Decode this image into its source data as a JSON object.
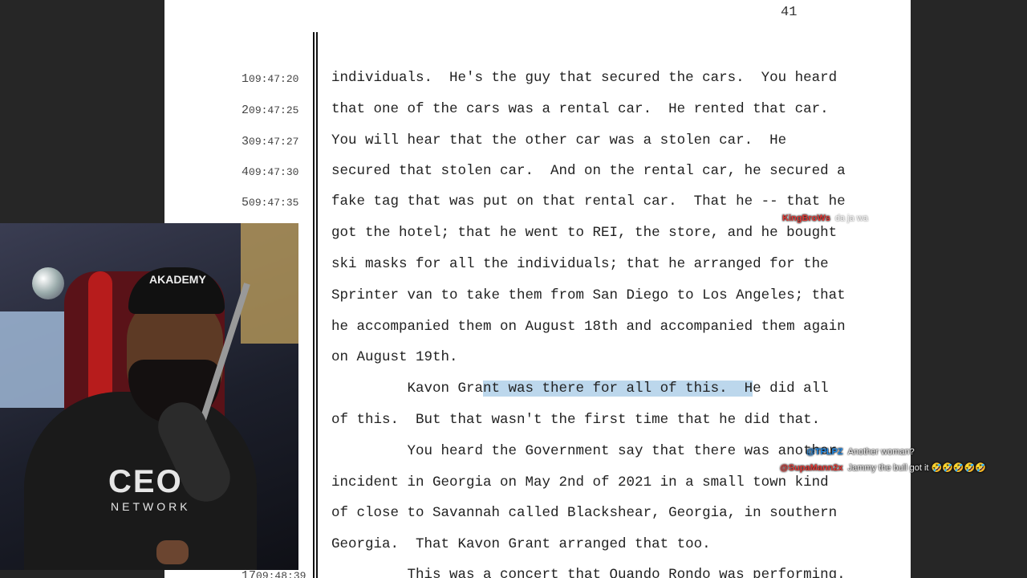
{
  "document": {
    "page_number": "41",
    "lines": [
      {
        "num": "1",
        "time": "09:47:20",
        "text": "individuals.  He's the guy that secured the cars.  You heard"
      },
      {
        "num": "2",
        "time": "09:47:25",
        "text": "that one of the cars was a rental car.  He rented that car."
      },
      {
        "num": "3",
        "time": "09:47:27",
        "text": "You will hear that the other car was a stolen car.  He"
      },
      {
        "num": "4",
        "time": "09:47:30",
        "text": "secured that stolen car.  And on the rental car, he secured a"
      },
      {
        "num": "5",
        "time": "09:47:35",
        "text": "fake tag that was put on that rental car.  That he -- that he"
      },
      {
        "num": "",
        "time": "",
        "text": "got the hotel; that he went to REI, the store, and he bought"
      },
      {
        "num": "",
        "time": "",
        "text": "ski masks for all the individuals; that he arranged for the"
      },
      {
        "num": "",
        "time": "",
        "text": "Sprinter van to take them from San Diego to Los Angeles; that"
      },
      {
        "num": "",
        "time": "",
        "text": "he accompanied them on August 18th and accompanied them again"
      },
      {
        "num": "",
        "time": "",
        "text": "on August 19th."
      },
      {
        "num": "",
        "time": "",
        "text": "",
        "pre": "         Kavon Gra",
        "highlight": "nt was there for all of this.  H",
        "post": "e did all"
      },
      {
        "num": "",
        "time": "",
        "text": "of this.  But that wasn't the first time that he did that."
      },
      {
        "num": "",
        "time": "",
        "text": "         You heard the Government say that there was another"
      },
      {
        "num": "",
        "time": "",
        "text": "incident in Georgia on May 2nd of 2021 in a small town kind"
      },
      {
        "num": "",
        "time": "",
        "text": "of close to Savannah called Blackshear, Georgia, in southern"
      },
      {
        "num": "",
        "time": "",
        "text": "Georgia.  That Kavon Grant arranged that too."
      },
      {
        "num": "17",
        "time": "09:48:39",
        "text": "         This was a concert that Quando Rondo was performing."
      }
    ]
  },
  "webcam": {
    "cap_text": "AKADEMY",
    "shirt_text": "CEO",
    "shirt_subtext": "NETWORK"
  },
  "chat": [
    {
      "user": "KingBroWs",
      "user_color": "#e53935",
      "message": "da ja wa",
      "faint": true
    },
    {
      "user": "@TPLPZ",
      "user_color": "#1e88e5",
      "message": "Another woman?",
      "faint": false
    },
    {
      "user": "@SupaMann2x",
      "user_color": "#e53935",
      "message": "Jammy the bull got it 🤣🤣🤣🤣🤣",
      "faint": false
    }
  ],
  "colors": {
    "highlight": "#bcd7ec",
    "background": "#262626"
  }
}
